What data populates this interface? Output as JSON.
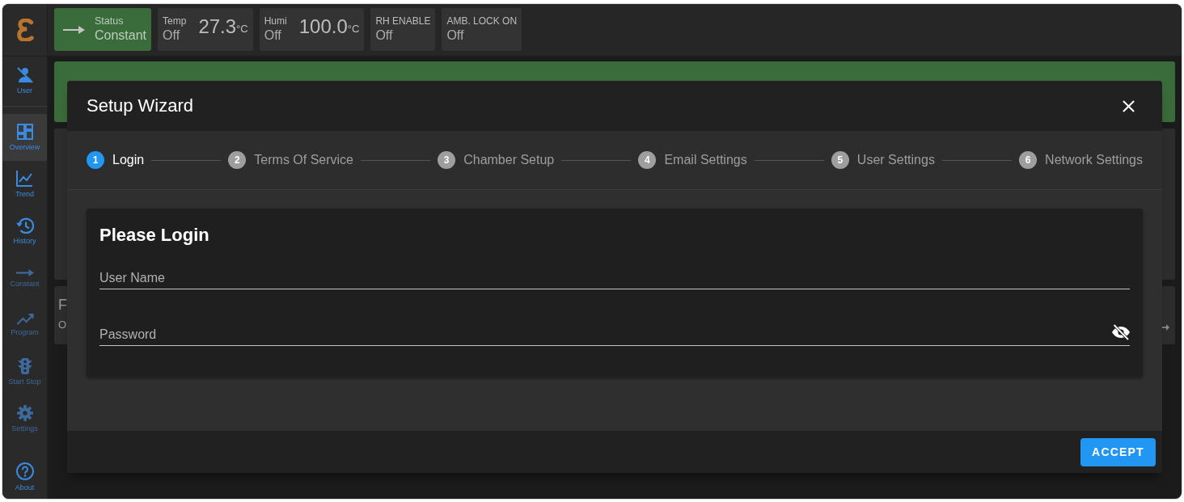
{
  "sidebar": {
    "user": {
      "label": "User"
    },
    "items": [
      {
        "label": "Overview",
        "selected": true,
        "disabled": false
      },
      {
        "label": "Trend",
        "selected": false,
        "disabled": false
      },
      {
        "label": "History",
        "selected": false,
        "disabled": false
      },
      {
        "label": "Constant",
        "selected": false,
        "disabled": true
      },
      {
        "label": "Program",
        "selected": false,
        "disabled": true
      },
      {
        "label": "Start Stop",
        "selected": false,
        "disabled": true
      },
      {
        "label": "Settings",
        "selected": false,
        "disabled": true
      }
    ],
    "about": {
      "label": "About"
    }
  },
  "header": {
    "tiles": [
      {
        "kind": "status",
        "label": "Status",
        "value": "Constant"
      },
      {
        "kind": "reading",
        "label": "Temp",
        "state": "Off",
        "value": "27.3",
        "unit": "°C"
      },
      {
        "kind": "reading",
        "label": "Humi",
        "state": "Off",
        "value": "100.0",
        "unit": "°C"
      },
      {
        "kind": "flag",
        "label": "RH ENABLE",
        "state": "Off"
      },
      {
        "kind": "flag",
        "label": "AMB. LOCK ON",
        "state": "Off"
      }
    ]
  },
  "background_card": {
    "title": "F",
    "subtitle": "O"
  },
  "dialog": {
    "title": "Setup Wizard",
    "steps": [
      {
        "number": "1",
        "label": "Login",
        "selected": true
      },
      {
        "number": "2",
        "label": "Terms Of Service",
        "selected": false
      },
      {
        "number": "3",
        "label": "Chamber Setup",
        "selected": false
      },
      {
        "number": "4",
        "label": "Email Settings",
        "selected": false
      },
      {
        "number": "5",
        "label": "User Settings",
        "selected": false
      },
      {
        "number": "6",
        "label": "Network Settings",
        "selected": false
      }
    ],
    "form": {
      "title": "Please Login",
      "fields": [
        {
          "kind": "text",
          "placeholder": "User Name"
        },
        {
          "kind": "password",
          "placeholder": "Password"
        }
      ]
    },
    "buttons": [
      "ACCEPT"
    ]
  }
}
